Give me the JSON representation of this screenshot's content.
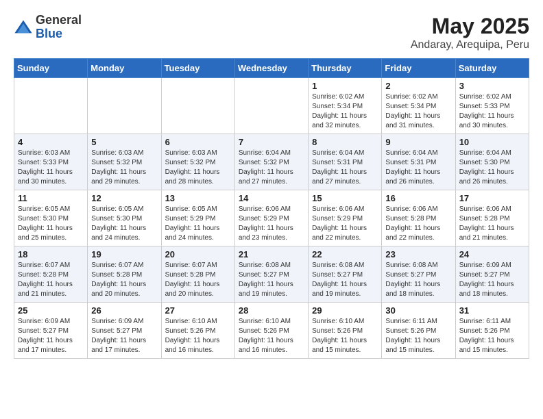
{
  "header": {
    "logo_general": "General",
    "logo_blue": "Blue",
    "month_year": "May 2025",
    "location": "Andaray, Arequipa, Peru"
  },
  "weekdays": [
    "Sunday",
    "Monday",
    "Tuesday",
    "Wednesday",
    "Thursday",
    "Friday",
    "Saturday"
  ],
  "weeks": [
    [
      {
        "day": "",
        "info": ""
      },
      {
        "day": "",
        "info": ""
      },
      {
        "day": "",
        "info": ""
      },
      {
        "day": "",
        "info": ""
      },
      {
        "day": "1",
        "info": "Sunrise: 6:02 AM\nSunset: 5:34 PM\nDaylight: 11 hours\nand 32 minutes."
      },
      {
        "day": "2",
        "info": "Sunrise: 6:02 AM\nSunset: 5:34 PM\nDaylight: 11 hours\nand 31 minutes."
      },
      {
        "day": "3",
        "info": "Sunrise: 6:02 AM\nSunset: 5:33 PM\nDaylight: 11 hours\nand 30 minutes."
      }
    ],
    [
      {
        "day": "4",
        "info": "Sunrise: 6:03 AM\nSunset: 5:33 PM\nDaylight: 11 hours\nand 30 minutes."
      },
      {
        "day": "5",
        "info": "Sunrise: 6:03 AM\nSunset: 5:32 PM\nDaylight: 11 hours\nand 29 minutes."
      },
      {
        "day": "6",
        "info": "Sunrise: 6:03 AM\nSunset: 5:32 PM\nDaylight: 11 hours\nand 28 minutes."
      },
      {
        "day": "7",
        "info": "Sunrise: 6:04 AM\nSunset: 5:32 PM\nDaylight: 11 hours\nand 27 minutes."
      },
      {
        "day": "8",
        "info": "Sunrise: 6:04 AM\nSunset: 5:31 PM\nDaylight: 11 hours\nand 27 minutes."
      },
      {
        "day": "9",
        "info": "Sunrise: 6:04 AM\nSunset: 5:31 PM\nDaylight: 11 hours\nand 26 minutes."
      },
      {
        "day": "10",
        "info": "Sunrise: 6:04 AM\nSunset: 5:30 PM\nDaylight: 11 hours\nand 26 minutes."
      }
    ],
    [
      {
        "day": "11",
        "info": "Sunrise: 6:05 AM\nSunset: 5:30 PM\nDaylight: 11 hours\nand 25 minutes."
      },
      {
        "day": "12",
        "info": "Sunrise: 6:05 AM\nSunset: 5:30 PM\nDaylight: 11 hours\nand 24 minutes."
      },
      {
        "day": "13",
        "info": "Sunrise: 6:05 AM\nSunset: 5:29 PM\nDaylight: 11 hours\nand 24 minutes."
      },
      {
        "day": "14",
        "info": "Sunrise: 6:06 AM\nSunset: 5:29 PM\nDaylight: 11 hours\nand 23 minutes."
      },
      {
        "day": "15",
        "info": "Sunrise: 6:06 AM\nSunset: 5:29 PM\nDaylight: 11 hours\nand 22 minutes."
      },
      {
        "day": "16",
        "info": "Sunrise: 6:06 AM\nSunset: 5:28 PM\nDaylight: 11 hours\nand 22 minutes."
      },
      {
        "day": "17",
        "info": "Sunrise: 6:06 AM\nSunset: 5:28 PM\nDaylight: 11 hours\nand 21 minutes."
      }
    ],
    [
      {
        "day": "18",
        "info": "Sunrise: 6:07 AM\nSunset: 5:28 PM\nDaylight: 11 hours\nand 21 minutes."
      },
      {
        "day": "19",
        "info": "Sunrise: 6:07 AM\nSunset: 5:28 PM\nDaylight: 11 hours\nand 20 minutes."
      },
      {
        "day": "20",
        "info": "Sunrise: 6:07 AM\nSunset: 5:28 PM\nDaylight: 11 hours\nand 20 minutes."
      },
      {
        "day": "21",
        "info": "Sunrise: 6:08 AM\nSunset: 5:27 PM\nDaylight: 11 hours\nand 19 minutes."
      },
      {
        "day": "22",
        "info": "Sunrise: 6:08 AM\nSunset: 5:27 PM\nDaylight: 11 hours\nand 19 minutes."
      },
      {
        "day": "23",
        "info": "Sunrise: 6:08 AM\nSunset: 5:27 PM\nDaylight: 11 hours\nand 18 minutes."
      },
      {
        "day": "24",
        "info": "Sunrise: 6:09 AM\nSunset: 5:27 PM\nDaylight: 11 hours\nand 18 minutes."
      }
    ],
    [
      {
        "day": "25",
        "info": "Sunrise: 6:09 AM\nSunset: 5:27 PM\nDaylight: 11 hours\nand 17 minutes."
      },
      {
        "day": "26",
        "info": "Sunrise: 6:09 AM\nSunset: 5:27 PM\nDaylight: 11 hours\nand 17 minutes."
      },
      {
        "day": "27",
        "info": "Sunrise: 6:10 AM\nSunset: 5:26 PM\nDaylight: 11 hours\nand 16 minutes."
      },
      {
        "day": "28",
        "info": "Sunrise: 6:10 AM\nSunset: 5:26 PM\nDaylight: 11 hours\nand 16 minutes."
      },
      {
        "day": "29",
        "info": "Sunrise: 6:10 AM\nSunset: 5:26 PM\nDaylight: 11 hours\nand 15 minutes."
      },
      {
        "day": "30",
        "info": "Sunrise: 6:11 AM\nSunset: 5:26 PM\nDaylight: 11 hours\nand 15 minutes."
      },
      {
        "day": "31",
        "info": "Sunrise: 6:11 AM\nSunset: 5:26 PM\nDaylight: 11 hours\nand 15 minutes."
      }
    ]
  ]
}
